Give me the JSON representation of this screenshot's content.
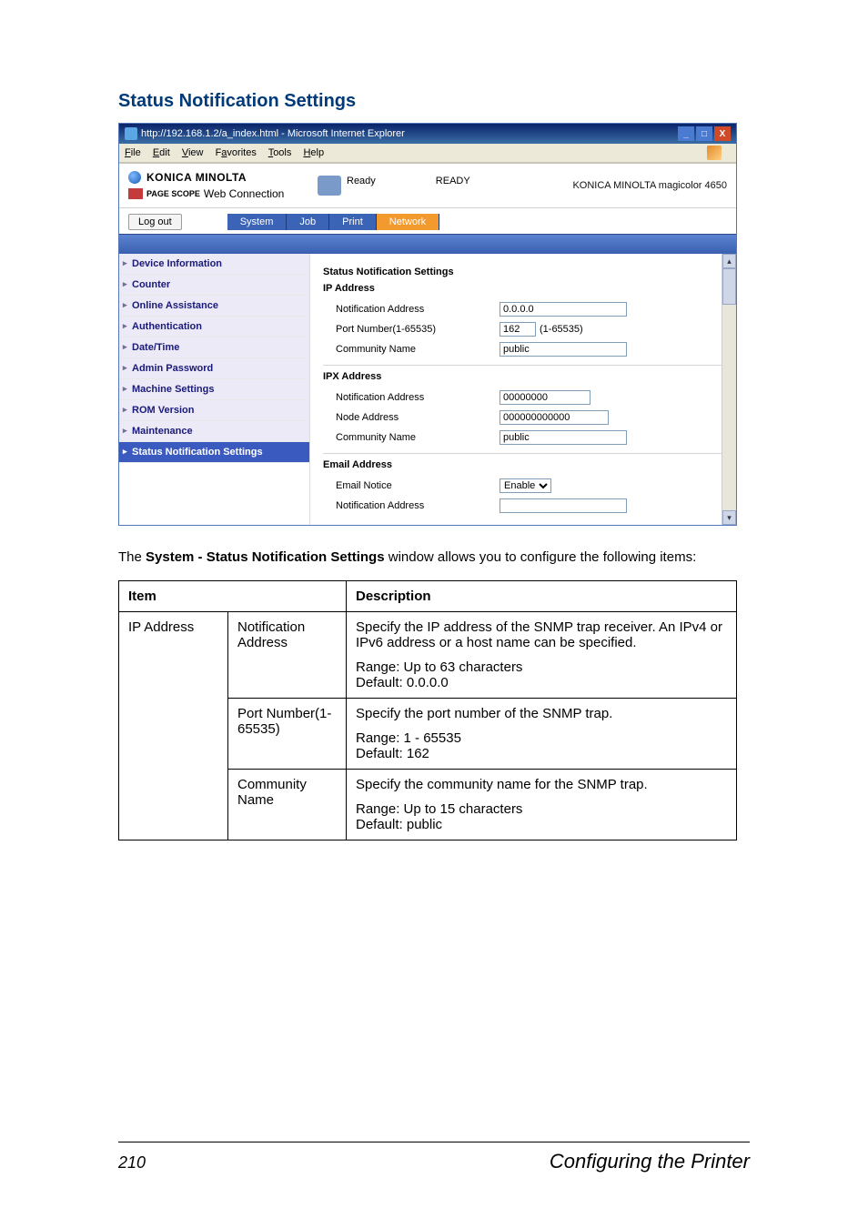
{
  "section_title": "Status Notification Settings",
  "browser": {
    "title": "http://192.168.1.2/a_index.html - Microsoft Internet Explorer",
    "menu": {
      "file": "File",
      "edit": "Edit",
      "view": "View",
      "favorites": "Favorites",
      "tools": "Tools",
      "help": "Help"
    }
  },
  "header": {
    "brand": "KONICA MINOLTA",
    "pagescope_small": "PAGE SCOPE",
    "pagescope_text": "Web Connection",
    "status_label": "Ready",
    "ready_big": "READY",
    "model": "KONICA MINOLTA magicolor 4650"
  },
  "logout": "Log out",
  "tabs": {
    "system": "System",
    "job": "Job",
    "print": "Print",
    "network": "Network"
  },
  "sidebar": {
    "items": [
      "Device Information",
      "Counter",
      "Online Assistance",
      "Authentication",
      "Date/Time",
      "Admin Password",
      "Machine Settings",
      "ROM Version",
      "Maintenance",
      "Status Notification Settings"
    ]
  },
  "panel": {
    "title": "Status Notification Settings",
    "group_ip": "IP Address",
    "notif_addr": "Notification Address",
    "notif_addr_val": "0.0.0.0",
    "port_label": "Port Number(1-65535)",
    "port_val": "162",
    "port_hint": "(1-65535)",
    "community": "Community Name",
    "community_val": "public",
    "group_ipx": "IPX Address",
    "ipx_notif_val": "00000000",
    "node_addr": "Node Address",
    "node_addr_val": "000000000000",
    "ipx_comm_val": "public",
    "group_email": "Email Address",
    "email_notice": "Email Notice",
    "email_enable": "Enable",
    "email_notif_addr_val": ""
  },
  "intro_pre": "The ",
  "intro_bold": "System - Status Notification Settings",
  "intro_post": " window allows you to configure the following items:",
  "table": {
    "headers": {
      "item": "Item",
      "desc": "Description"
    },
    "rows": [
      {
        "c1": "IP Address",
        "c2": "Notification Address",
        "d_main": "Specify the IP address of the SNMP trap receiver. An IPv4 or IPv6 address or a host name can be specified.",
        "d_sub": "Range: Up to 63 characters\nDefault: 0.0.0.0"
      },
      {
        "c1": "",
        "c2": "Port Number(1-65535)",
        "d_main": "Specify the port number of the SNMP trap.",
        "d_sub": "Range: 1 - 65535\nDefault: 162"
      },
      {
        "c1": "",
        "c2": "Community Name",
        "d_main": "Specify the community name for the SNMP trap.",
        "d_sub": "Range: Up to 15 characters\nDefault: public"
      }
    ]
  },
  "footer": {
    "page": "210",
    "title": "Configuring the Printer"
  }
}
